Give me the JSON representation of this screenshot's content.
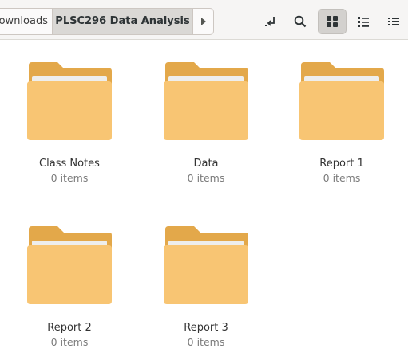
{
  "breadcrumb": {
    "previous": "Downloads",
    "current": "PLSC296 Data Analysis"
  },
  "toolbar": {
    "icons": [
      "open-location-icon",
      "search-icon",
      "grid-view-icon",
      "list-view-icon",
      "view-options-icon"
    ],
    "active_view": "grid"
  },
  "colors": {
    "folder_back": "#e3a84a",
    "folder_front": "#f8c573",
    "folder_paper": "#eeeeec"
  },
  "items": [
    {
      "name": "Class Notes",
      "count": "0 items"
    },
    {
      "name": "Data",
      "count": "0 items"
    },
    {
      "name": "Report 1",
      "count": "0 items"
    },
    {
      "name": "Report 2",
      "count": "0 items"
    },
    {
      "name": "Report 3",
      "count": "0 items"
    }
  ]
}
